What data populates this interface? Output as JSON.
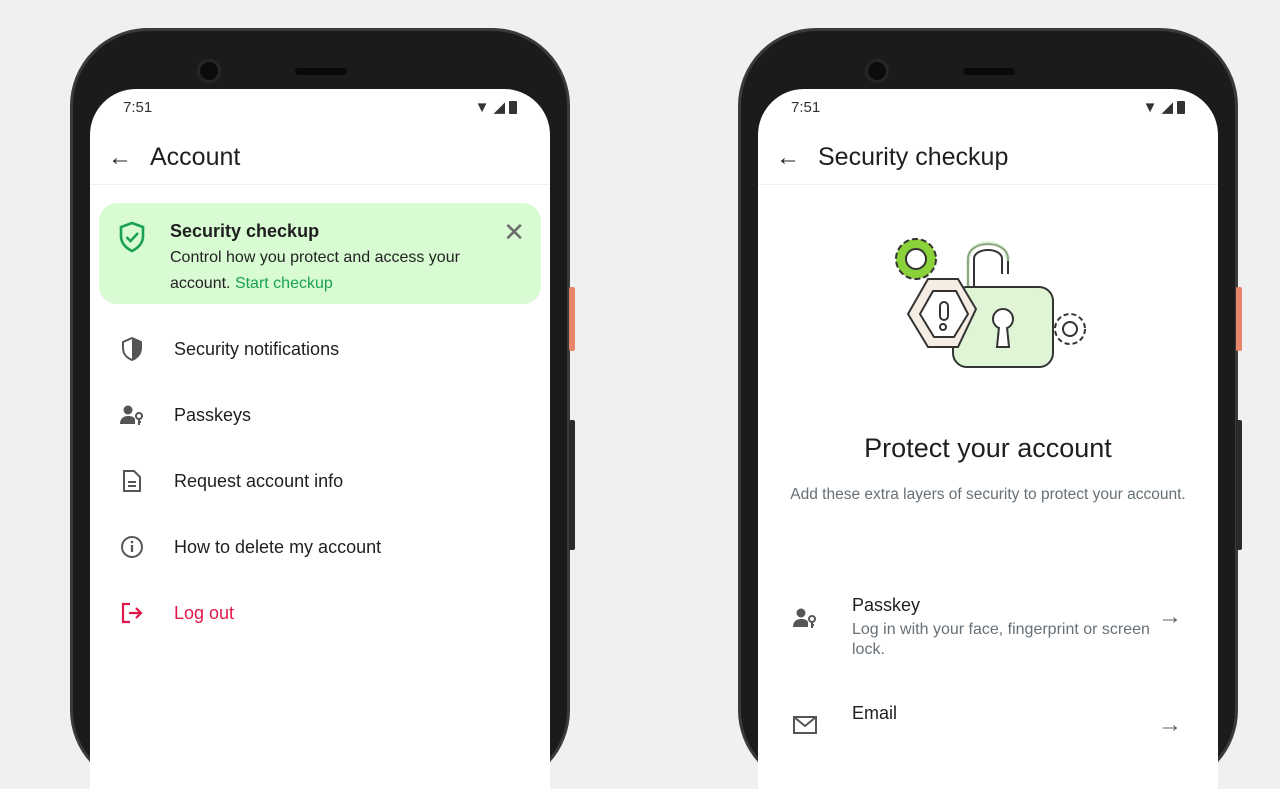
{
  "left": {
    "status_time": "7:51",
    "title": "Account",
    "card": {
      "title": "Security checkup",
      "body": "Control how you protect and access your account.",
      "link": "Start checkup"
    },
    "items": [
      {
        "label": "Security notifications",
        "icon": "shield-half-icon"
      },
      {
        "label": "Passkeys",
        "icon": "person-key-icon"
      },
      {
        "label": "Request account info",
        "icon": "document-icon"
      },
      {
        "label": "How to delete my account",
        "icon": "info-icon"
      },
      {
        "label": "Log out",
        "icon": "logout-icon"
      }
    ]
  },
  "right": {
    "status_time": "7:51",
    "title": "Security checkup",
    "heading": "Protect your account",
    "subtitle": "Add these extra layers of security to protect your account.",
    "options": [
      {
        "title": "Passkey",
        "desc": "Log in with your face, fingerprint or screen lock.",
        "icon": "person-key-icon"
      },
      {
        "title": "Email",
        "desc": "",
        "icon": "mail-icon"
      }
    ]
  },
  "colors": {
    "accent": "#1aa250",
    "card_bg": "#d8fbd3",
    "danger": "#e0174a"
  }
}
